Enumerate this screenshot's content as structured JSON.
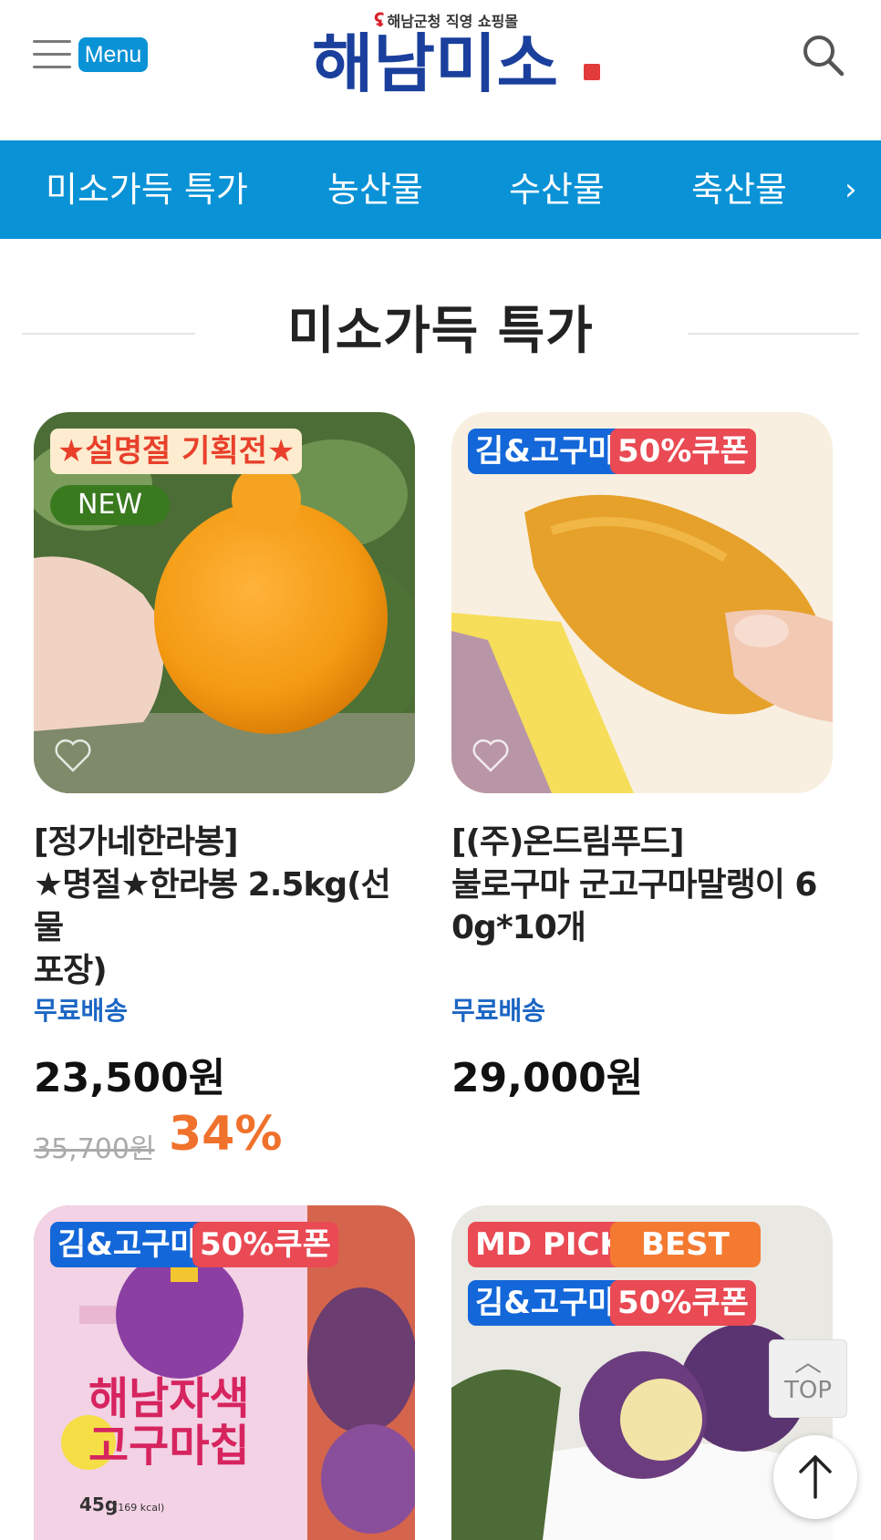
{
  "header": {
    "menu_label": "Menu",
    "logo_tagline": "해남군청 직영 쇼핑몰",
    "logo_text": "해남미소",
    "logo_seal": "해남미소",
    "icons": {
      "menu": "hamburger-icon",
      "search": "search-icon"
    }
  },
  "nav": {
    "items": [
      "미소가득 특가",
      "농산물",
      "수산물",
      "축산물"
    ],
    "more_icon": "chevron-right-icon"
  },
  "section": {
    "title": "미소가득 특가"
  },
  "colors": {
    "brand": "#0a92d6",
    "price_discount": "#f0712c",
    "shipping": "#1b66c4"
  },
  "products": [
    {
      "badges": [
        "★설명절 기획전★",
        "NEW"
      ],
      "name": "[정가네한라봉] ★명절★한라봉 2.5kg(선물포장)",
      "name_lines": [
        "[정가네한라봉]",
        "★명절★한라봉 2.5kg(선물",
        "포장)"
      ],
      "shipping": "무료배송",
      "price": "23,500원",
      "original_price": "35,700원",
      "discount": "34%"
    },
    {
      "badges": [
        "김&고구마",
        "50%쿠폰"
      ],
      "name": "[(주)온드림푸드] 불로구마 군고구마말랭이 60g*10개",
      "name_lines": [
        "[(주)온드림푸드]",
        "불로구마 군고구마말랭이 6",
        "0g*10개"
      ],
      "shipping": "무료배송",
      "price": "29,000원"
    },
    {
      "badges": [
        "김&고구마",
        "50%쿠폰"
      ],
      "package_text": {
        "title_1": "해남자색",
        "title_2": "고구마칩",
        "weight": "45g",
        "kcal": "(169 kcal)"
      }
    },
    {
      "badges": [
        "MD PICK",
        "BEST",
        "김&고구마",
        "50%쿠폰"
      ]
    }
  ],
  "floating": {
    "top_label": "TOP",
    "scroll_up_icon": "arrow-up-icon"
  }
}
